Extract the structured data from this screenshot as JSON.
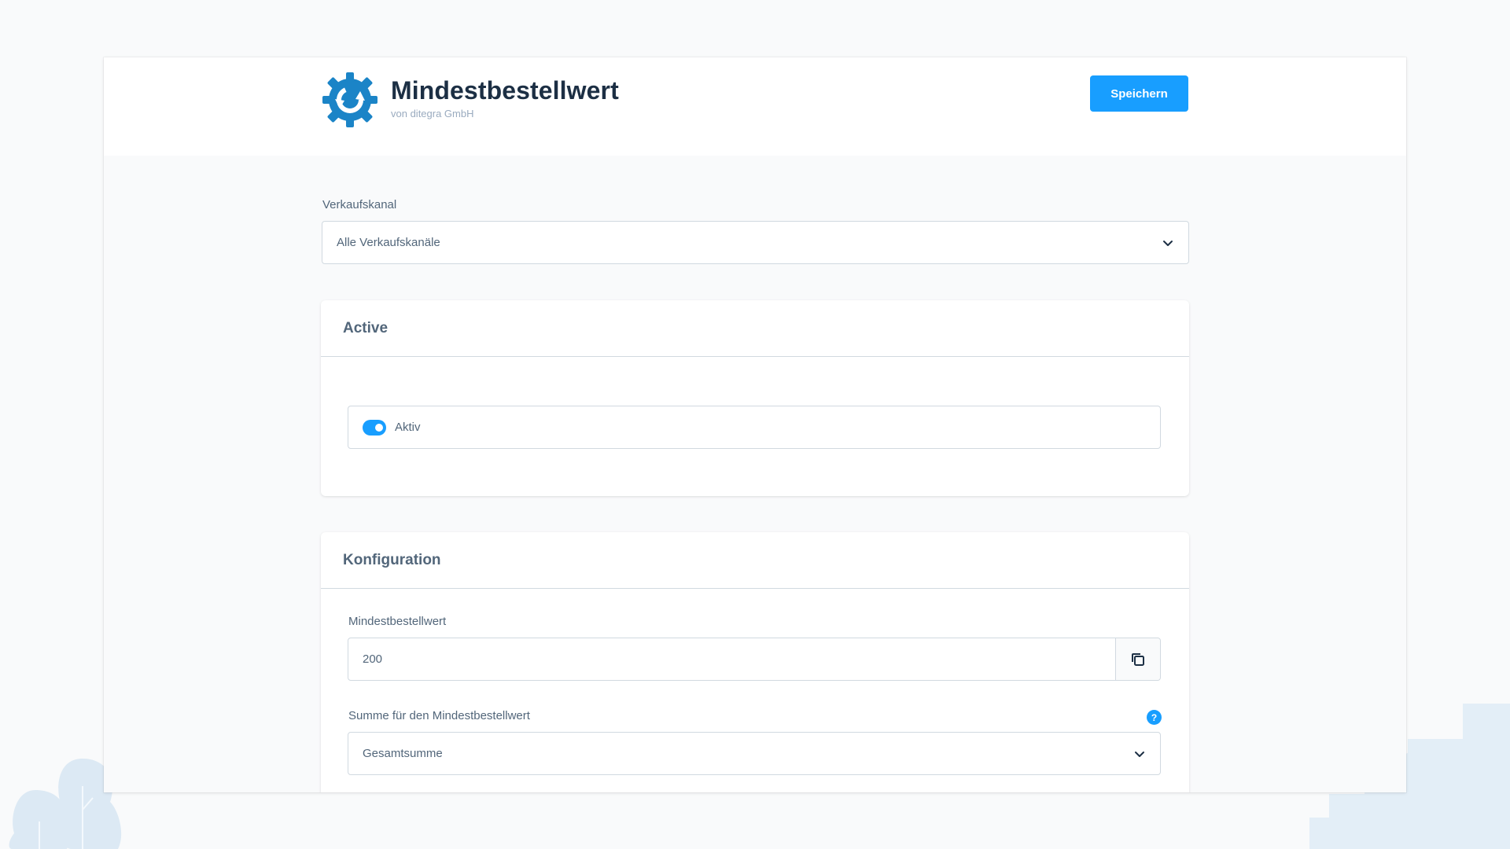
{
  "header": {
    "title": "Mindestbestellwert",
    "vendor": "von ditegra GmbH",
    "save_label": "Speichern",
    "logo_icon": "gear-refresh-logo-icon"
  },
  "sales_channel": {
    "label": "Verkaufskanal",
    "selected": "Alle Verkaufskanäle"
  },
  "active_card": {
    "title": "Active",
    "toggle_label": "Aktiv",
    "toggle_on": true
  },
  "config_card": {
    "title": "Konfiguration",
    "min_order_label": "Mindestbestellwert",
    "min_order_value": "200",
    "sum_label": "Summe für den Mindestbestellwert",
    "sum_selected": "Gesamtsumme",
    "help_glyph": "?"
  },
  "colors": {
    "accent": "#189eff",
    "title": "#1c2f44",
    "text": "#52667a",
    "border": "#d1d9e0"
  }
}
